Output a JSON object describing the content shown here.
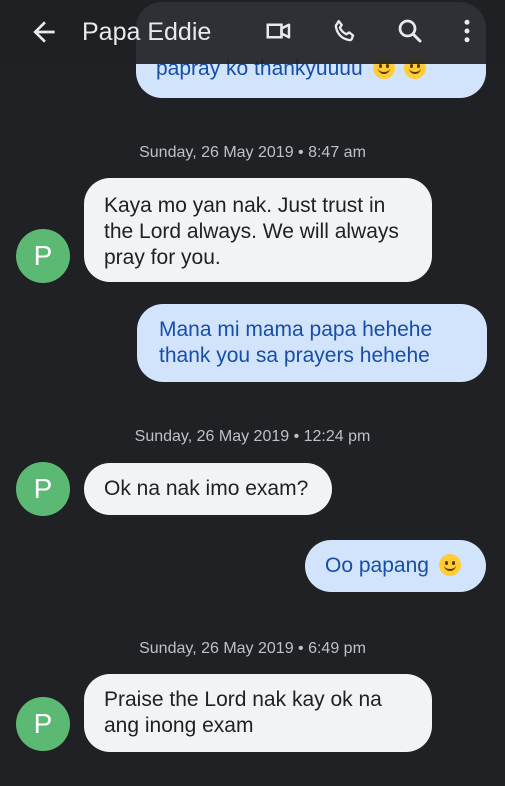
{
  "header": {
    "title": "Papa Eddie",
    "icons": [
      "back-arrow-icon",
      "video-call-icon",
      "phone-icon",
      "search-icon",
      "more-vert-icon"
    ]
  },
  "colors": {
    "background": "#202124",
    "incoming_bubble": "#f1f3f4",
    "outgoing_bubble": "#d2e3fc",
    "outgoing_text": "#174ea6",
    "avatar": "#5bb974"
  },
  "messages": {
    "top_partial": "papray ko thankyuuuu",
    "ts1": "Sunday, 26 May 2019 • 8:47 am",
    "m1": "Kaya mo yan nak. Just trust in the Lord always. We will always pray for you.",
    "m2": "Mana mi mama papa hehehe thank you sa prayers hehehe",
    "ts2": "Sunday, 26 May 2019 • 12:24 pm",
    "m3": "Ok na nak imo exam?",
    "m4": "Oo papang",
    "ts3": "Sunday, 26 May 2019 • 6:49 pm",
    "m5": "Praise the Lord nak kay ok na ang inong exam"
  },
  "avatar_letter": "P"
}
